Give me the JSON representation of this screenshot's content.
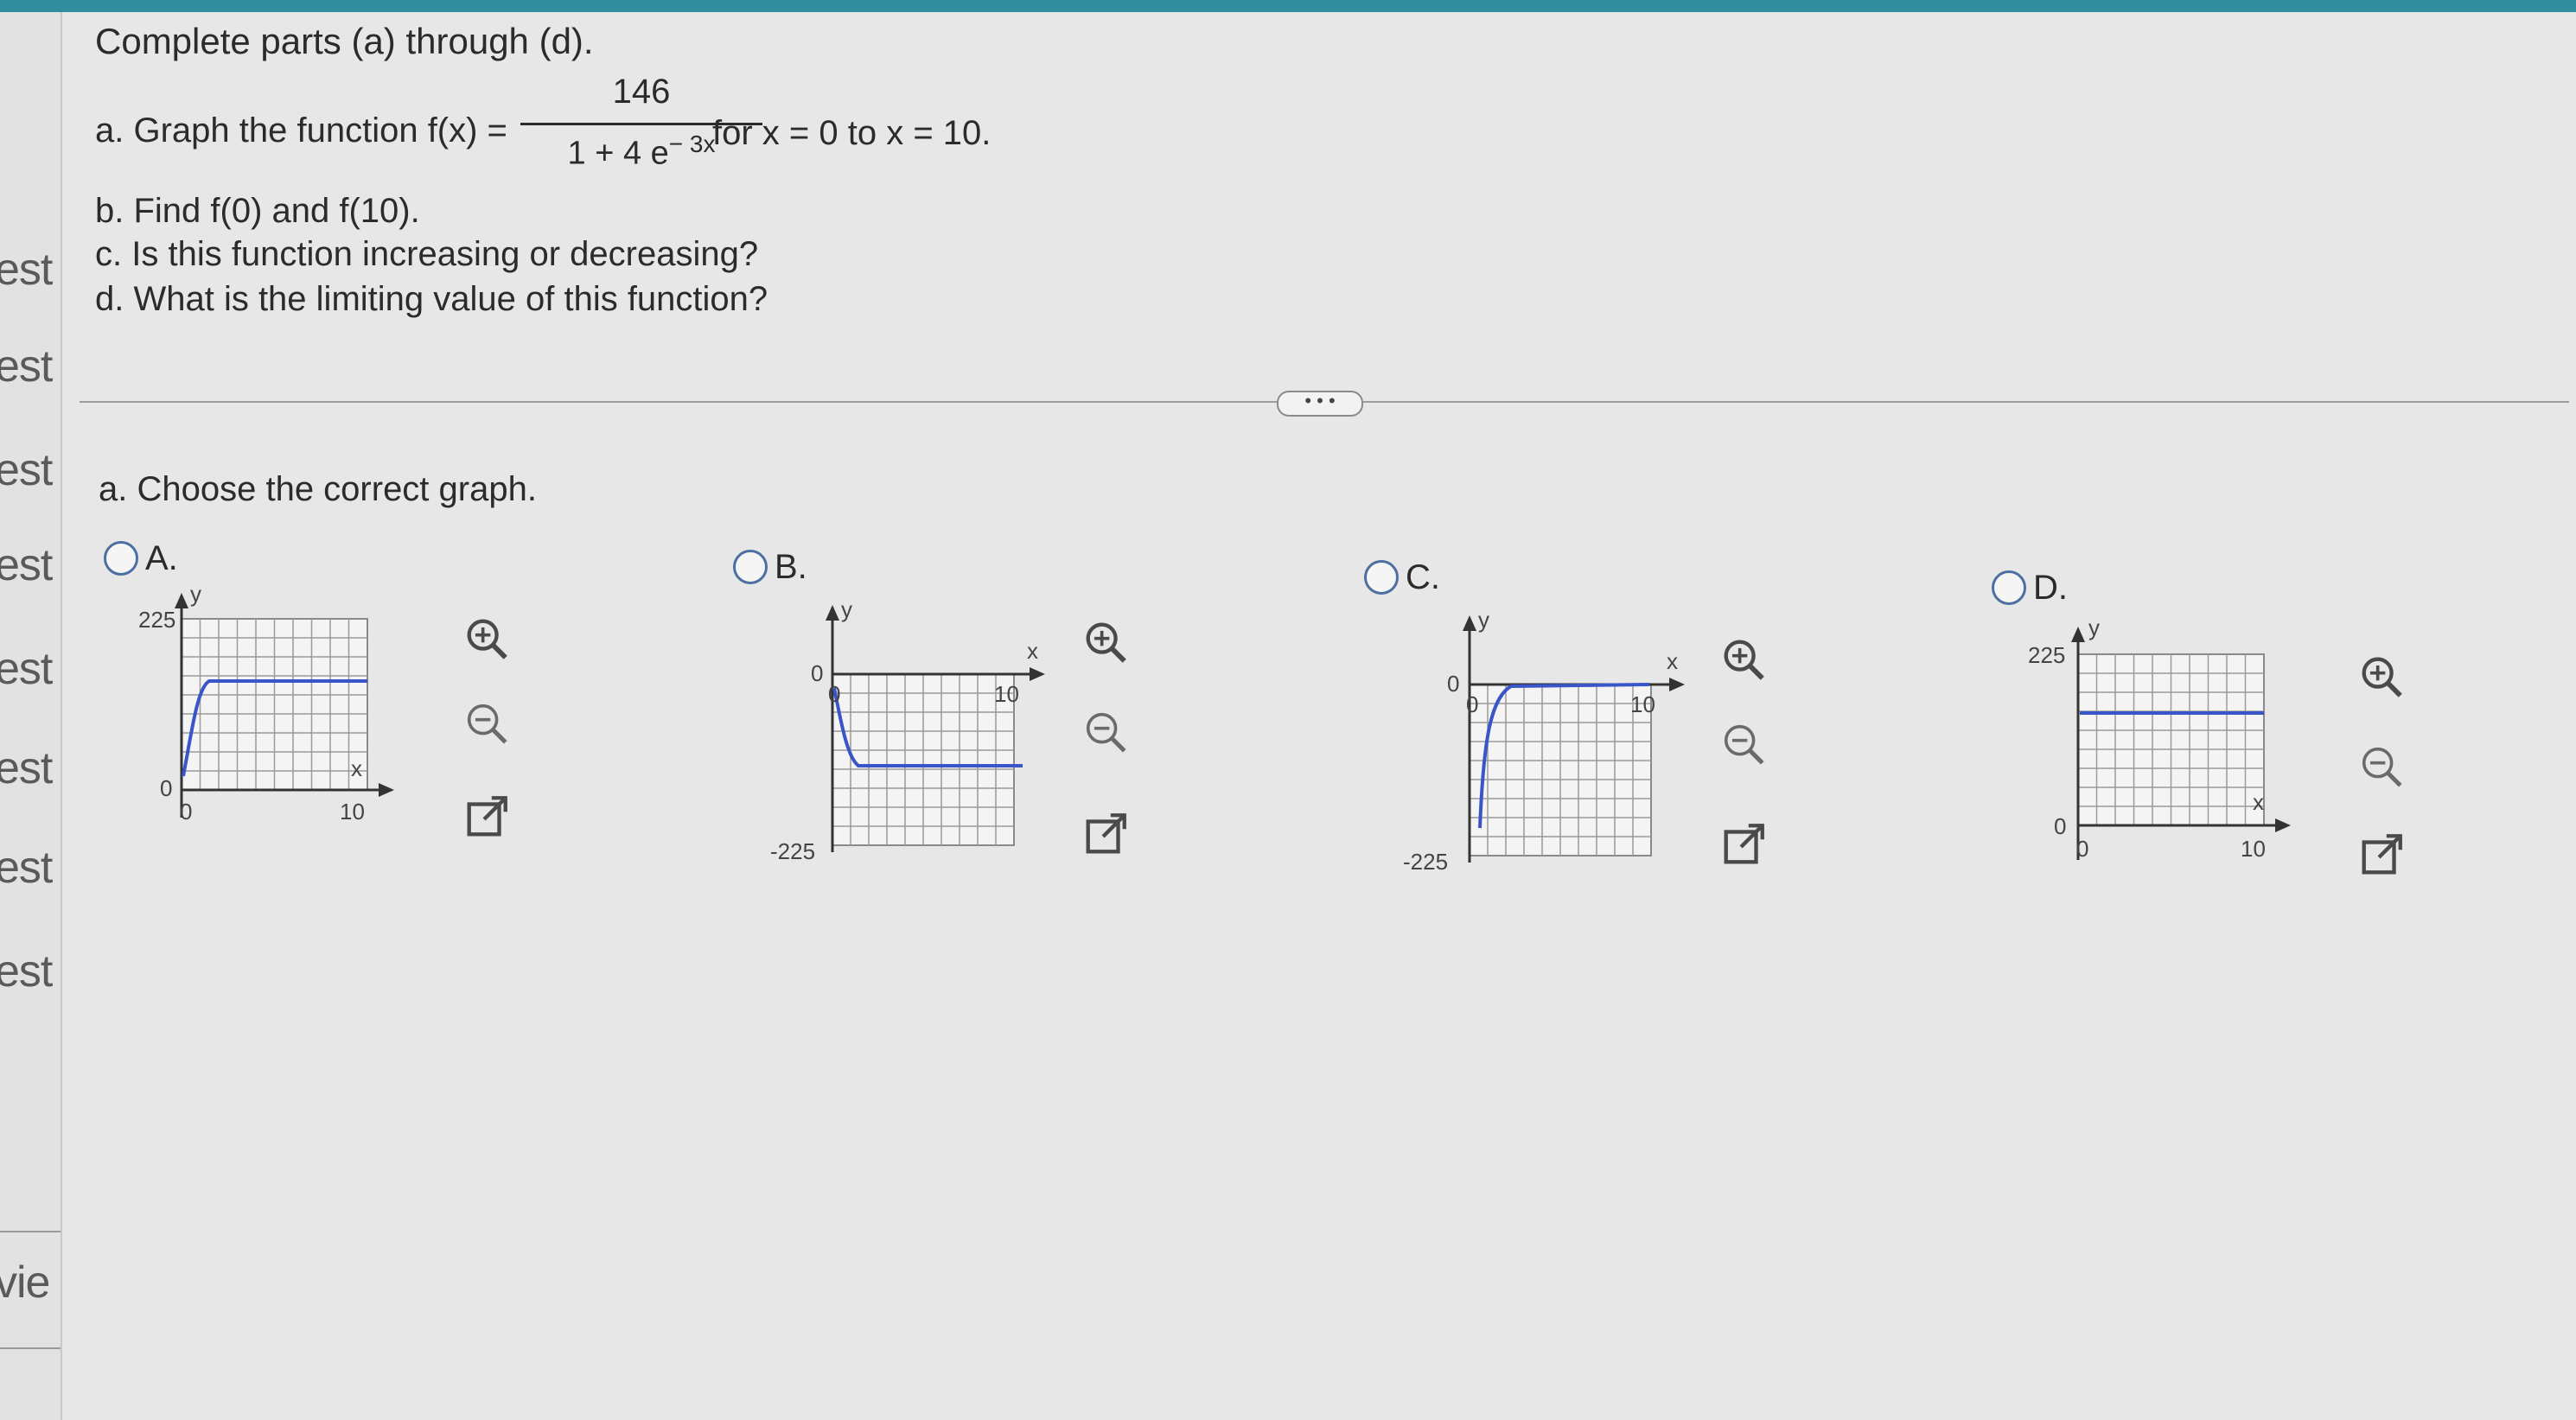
{
  "sidebar": {
    "labels": [
      "est",
      "est",
      "est",
      "est",
      "est",
      "est",
      "est",
      "est",
      "vie"
    ]
  },
  "question": {
    "intro": "Complete parts (a) through (d).",
    "part_a_prefix": "a. Graph the function f(x) =",
    "numerator": "146",
    "denominator_base": "1 + 4 e",
    "denominator_exponent": "− 3x",
    "part_a_suffix": "for x = 0 to x = 10.",
    "part_b": "b. Find f(0) and f(10).",
    "part_c": "c. Is this function increasing or decreasing?",
    "part_d": "d. What is the limiting value of this function?"
  },
  "more_button": "• • •",
  "answer": {
    "prompt": "a. Choose the correct graph."
  },
  "options": [
    {
      "letter": "A.",
      "ylabel": "y",
      "xlabel": "x",
      "ymax": "225",
      "ymin": "0",
      "xmin": "0",
      "xmax": "10"
    },
    {
      "letter": "B.",
      "ylabel": "y",
      "xlabel": "x",
      "ytop": "0",
      "ybottom": "-225",
      "x0": "0",
      "xmax": "10"
    },
    {
      "letter": "C.",
      "ylabel": "y",
      "xlabel": "x",
      "ytop": "0",
      "ybottom": "-225",
      "x0": "0",
      "xmax": "10"
    },
    {
      "letter": "D.",
      "ylabel": "y",
      "xlabel": "x",
      "ymax": "225",
      "ymin": "0",
      "xmin": "0",
      "xmax": "10"
    }
  ],
  "colors": {
    "curve": "#3a55c8",
    "grid": "#9a9a9a",
    "accent_bar": "#2f8d9e"
  },
  "icons": [
    "zoom-in-icon",
    "zoom-out-icon",
    "external-link-icon"
  ]
}
